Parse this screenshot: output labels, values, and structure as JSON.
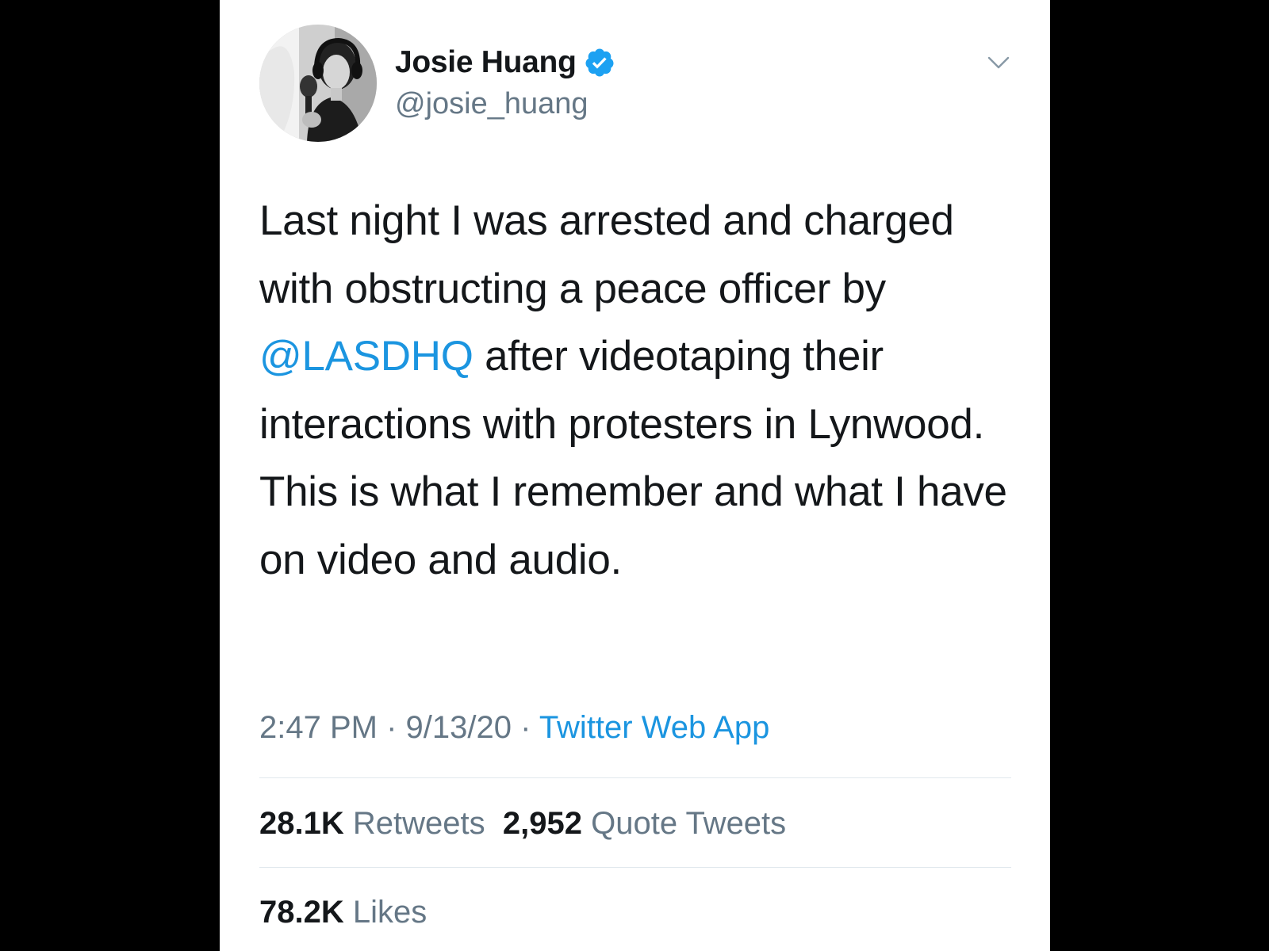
{
  "colors": {
    "background": "#000000",
    "card": "#ffffff",
    "text_primary": "#14171a",
    "text_secondary": "#657786",
    "link": "#1b95e0",
    "verified_badge": "#1da1f2",
    "divider": "#e1e8ed"
  },
  "author": {
    "display_name": "Josie Huang",
    "handle": "@josie_huang",
    "verified": true,
    "avatar_icon": "profile-photo",
    "menu_icon": "chevron-down-icon"
  },
  "tweet": {
    "text_before_mention": "Last night I was arrested and charged with obstructing a peace officer by ",
    "mention": "@LASDHQ",
    "text_after_mention": " after videotaping their interactions with protesters in Lynwood. This is what I remember and what I have on video and audio."
  },
  "meta": {
    "time": "2:47 PM",
    "separator": " · ",
    "date": "9/13/20",
    "source": "Twitter Web App"
  },
  "stats": {
    "retweets_count": "28.1K",
    "retweets_label": "Retweets",
    "quote_tweets_count": "2,952",
    "quote_tweets_label": "Quote Tweets",
    "likes_count": "78.2K",
    "likes_label": "Likes"
  }
}
